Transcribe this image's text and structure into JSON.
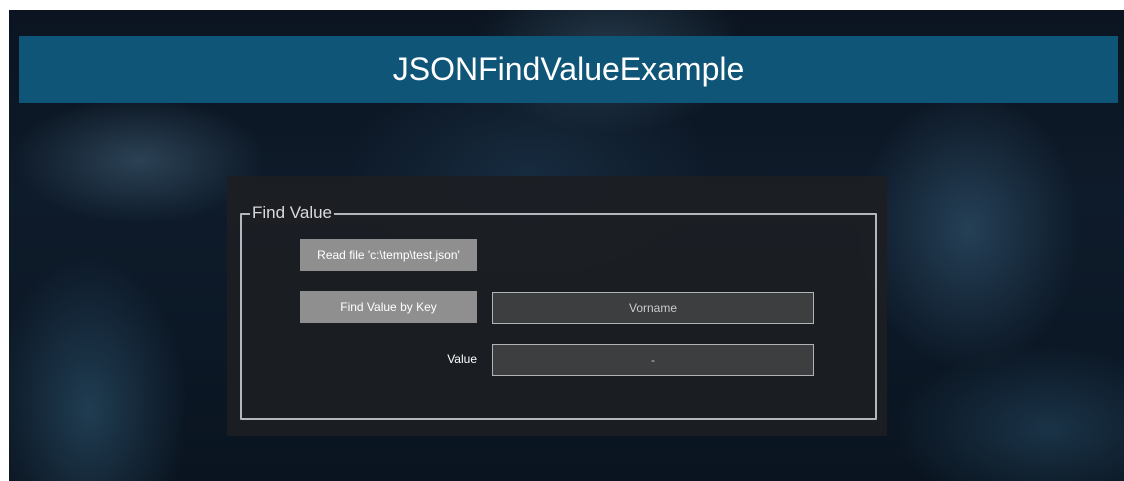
{
  "window": {
    "title": "JSONFindValueExample"
  },
  "group": {
    "legend": "Find Value",
    "read_button_label": "Read file 'c:\\temp\\test.json'",
    "find_button_label": "Find Value by Key",
    "key_input_value": "Vorname",
    "value_label": "Value",
    "value_output": "-"
  },
  "colors": {
    "title_bar": "#0e5577",
    "button_bg": "#8f8f8f",
    "panel_bg": "#1c1e22",
    "field_bg": "#3c3e40"
  }
}
